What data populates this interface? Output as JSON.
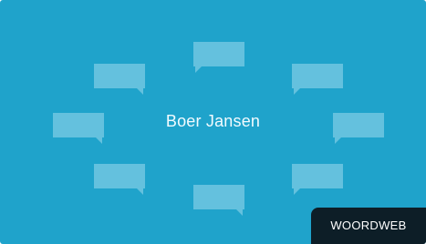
{
  "card": {
    "title": "Boer Jansen",
    "badge_label": "WOORDWEB",
    "bubble_count": 8
  },
  "colors": {
    "background": "#1fa3cb",
    "bubble": "#64c1de",
    "badge_background": "#0d1e27",
    "text": "#f2fbff"
  },
  "icons": [
    "speech-bubble-icon"
  ]
}
